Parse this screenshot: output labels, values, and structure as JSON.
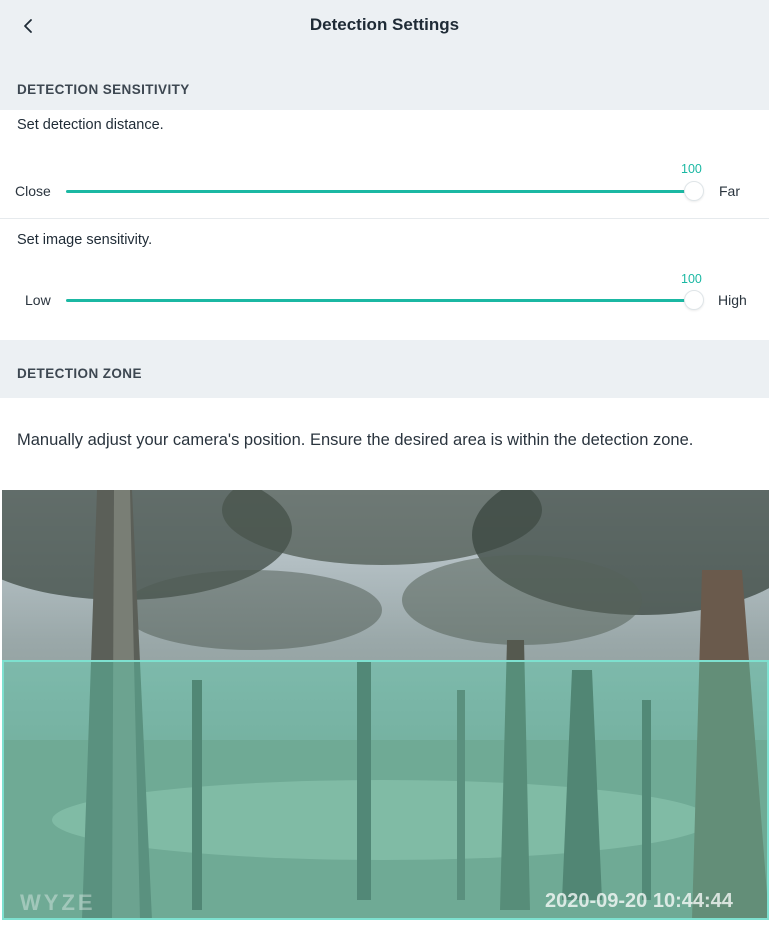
{
  "header": {
    "title": "Detection Settings",
    "back_icon": "chevron-left-icon"
  },
  "sensitivity_section": {
    "heading": "DETECTION SENSITIVITY",
    "distance": {
      "label": "Set detection distance.",
      "min_label": "Close",
      "max_label": "Far",
      "value": "100",
      "fraction": 1.0
    },
    "image": {
      "label": "Set image sensitivity.",
      "min_label": "Low",
      "max_label": "High",
      "value": "100",
      "fraction": 1.0
    }
  },
  "zone_section": {
    "heading": "DETECTION ZONE",
    "description": "Manually adjust your camera's position. Ensure the desired area is within the detection zone."
  },
  "camera": {
    "watermark": "WYZE",
    "timestamp": "2020-09-20  10:44:44"
  },
  "colors": {
    "accent": "#1bb8a3",
    "section_bg": "#ecf0f3",
    "zone_fill": "#5ad6b4"
  }
}
